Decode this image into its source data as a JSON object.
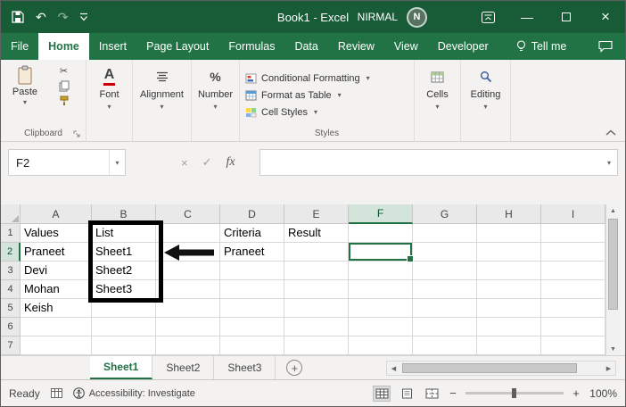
{
  "colors": {
    "excel_green": "#217346",
    "title_bar_green": "#185C37",
    "selection_border": "#217346"
  },
  "titlebar": {
    "title": "Book1 - Excel",
    "user_name": "NIRMAL",
    "user_initial": "N"
  },
  "ribbon_tabs": {
    "items": [
      "File",
      "Home",
      "Insert",
      "Page Layout",
      "Formulas",
      "Data",
      "Review",
      "View",
      "Developer"
    ],
    "active_tab": "Home",
    "tell_me_label": "Tell me"
  },
  "ribbon": {
    "paste_label": "Paste",
    "clipboard_group_label": "Clipboard",
    "font_label": "Font",
    "alignment_label": "Alignment",
    "number_label": "Number",
    "conditional_formatting_label": "Conditional Formatting",
    "format_as_table_label": "Format as Table",
    "cell_styles_label": "Cell Styles",
    "styles_group_label": "Styles",
    "cells_label": "Cells",
    "editing_label": "Editing"
  },
  "formula_bar": {
    "name_box_value": "F2",
    "fx_label": "fx",
    "formula_value": ""
  },
  "grid": {
    "column_headers": [
      "A",
      "B",
      "C",
      "D",
      "E",
      "F",
      "G",
      "H",
      "I"
    ],
    "row_count": 7,
    "selected_cell": {
      "col": "F",
      "row": 2
    },
    "rows": [
      {
        "n": 1,
        "cells": {
          "A": "Values",
          "B": "List",
          "D": "Criteria",
          "E": "Result"
        }
      },
      {
        "n": 2,
        "cells": {
          "A": "Praneet",
          "B": "Sheet1",
          "D": "Praneet"
        }
      },
      {
        "n": 3,
        "cells": {
          "A": "Devi",
          "B": "Sheet2"
        }
      },
      {
        "n": 4,
        "cells": {
          "A": "Mohan",
          "B": "Sheet3"
        }
      },
      {
        "n": 5,
        "cells": {
          "A": "Keish"
        }
      },
      {
        "n": 6,
        "cells": {}
      },
      {
        "n": 7,
        "cells": {}
      }
    ]
  },
  "sheet_tabs": {
    "tabs": [
      "Sheet1",
      "Sheet2",
      "Sheet3"
    ],
    "active_tab": "Sheet1",
    "add_sheet_label": "+"
  },
  "status_bar": {
    "mode": "Ready",
    "accessibility_text": "Accessibility: Investigate",
    "zoom_value": "100%"
  },
  "icons": {
    "undo": "↶",
    "redo": "↷",
    "cut": "✂",
    "dropdown_caret": "▾",
    "minimize": "—",
    "close": "×",
    "cancel": "×",
    "enter": "✓",
    "scroll_up": "▲",
    "scroll_down": "▼",
    "scroll_left": "◀",
    "scroll_right": "▶",
    "zoom_out": "−",
    "zoom_in": "+",
    "font_letter": "A",
    "percent": "%"
  }
}
